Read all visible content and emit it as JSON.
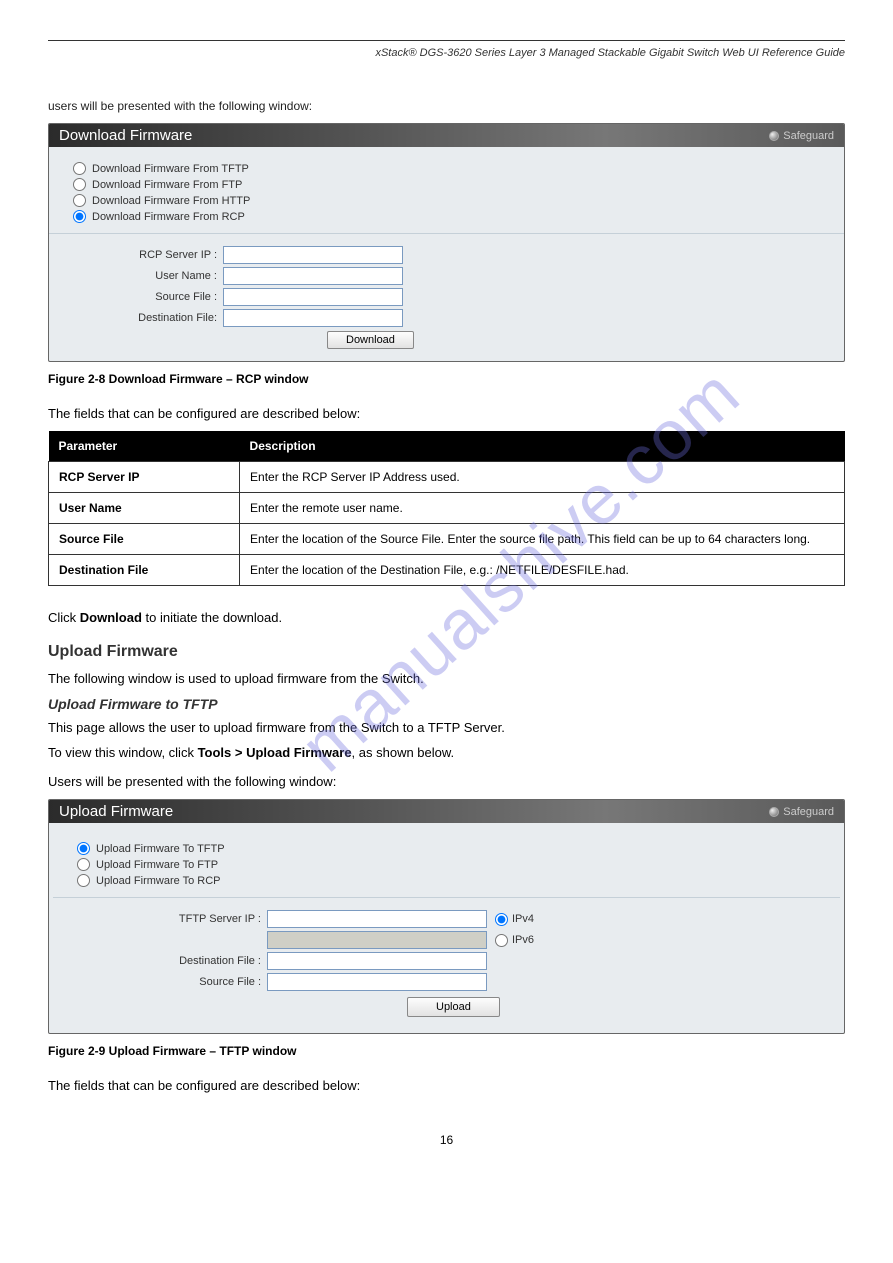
{
  "header": {
    "doc_title": "xStack® DGS-3620 Series Layer 3 Managed Stackable Gigabit Switch Web UI Reference Guide"
  },
  "fig1": {
    "intro": "users will be presented with the following window:",
    "panel_title": "Download Firmware",
    "safeguard": "Safeguard",
    "radios": {
      "tftp": "Download Firmware From TFTP",
      "ftp": "Download Firmware From FTP",
      "http": "Download Firmware From HTTP",
      "rcp": "Download Firmware From RCP"
    },
    "labels": {
      "rcp_server_ip": "RCP Server IP :",
      "user_name": "User Name :",
      "source_file": "Source File :",
      "destination_file": "Destination File:"
    },
    "button": "Download",
    "caption": "Figure 2-8 Download Firmware – RCP window",
    "desc_intro": "The fields that can be configured are described below:"
  },
  "table1": {
    "head_param": "Parameter",
    "head_desc": "Description",
    "rows": [
      {
        "param": "RCP Server IP",
        "desc": "Enter the RCP Server IP Address used."
      },
      {
        "param": "User Name",
        "desc": "Enter the remote user name."
      },
      {
        "param": "Source File",
        "desc": "Enter the location of the Source File. Enter the source file path. This field can be up to 64 characters long."
      },
      {
        "param": "Destination File",
        "desc": "Enter the location of the Destination File, e.g.: /NETFILE/DESFILE.had."
      }
    ]
  },
  "after_table1": "Click Download to initiate the download.",
  "section_heading": "Upload Firmware",
  "section_lead": "The following window is used to upload firmware from the Switch.",
  "sub1": {
    "title": "Upload Firmware to TFTP",
    "desc": "This page allows the user to upload firmware from the Switch to a TFTP Server.",
    "nav_prefix": "To view this window, click ",
    "nav_bold": "Tools > Upload Firmware",
    "nav_suffix": ", as shown below.",
    "intro2": "Users will be presented with the following window:"
  },
  "fig2": {
    "panel_title": "Upload Firmware",
    "safeguard": "Safeguard",
    "radios": {
      "tftp": "Upload Firmware To TFTP",
      "ftp": "Upload Firmware To FTP",
      "rcp": "Upload Firmware To RCP"
    },
    "labels": {
      "tftp_server_ip": "TFTP Server IP :",
      "destination_file": "Destination File :",
      "source_file": "Source File :",
      "ipv4": "IPv4",
      "ipv6": "IPv6"
    },
    "button": "Upload",
    "caption": "Figure 2-9 Upload Firmware – TFTP window",
    "desc_intro": "The fields that can be configured are described below:"
  },
  "page_number": "16",
  "watermark": "manualshive.com"
}
